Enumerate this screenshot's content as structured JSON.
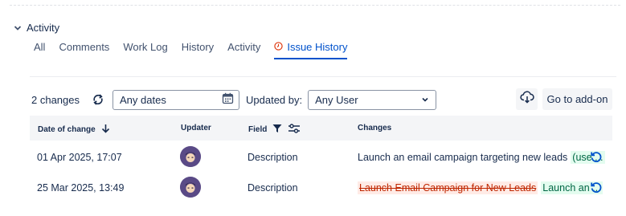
{
  "section": {
    "title": "Activity"
  },
  "tabs": [
    {
      "label": "All"
    },
    {
      "label": "Comments"
    },
    {
      "label": "Work Log"
    },
    {
      "label": "History"
    },
    {
      "label": "Activity"
    },
    {
      "label": "Issue History",
      "active": true
    }
  ],
  "toolbar": {
    "changes_count": "2 changes",
    "date_filter": "Any dates",
    "updated_by_label": "Updated by:",
    "user_filter": "Any User",
    "addon_button": "Go to add-on"
  },
  "table": {
    "columns": [
      "Date of change",
      "Updater",
      "Field",
      "Changes"
    ],
    "rows": [
      {
        "date": "01 Apr 2025, 17:07",
        "field": "Description",
        "plain_change": "Launch an email campaign targeting new leads",
        "added_change": "(use ..."
      },
      {
        "date": "25 Mar 2025, 13:49",
        "field": "Description",
        "removed_change": "Launch Email Campaign for New Leads",
        "added_change": "Launch an ..."
      }
    ]
  },
  "colors": {
    "accent": "#0052cc",
    "added_bg": "#e3fcef",
    "removed_bg": "#ffebe6",
    "avatar": "#5a4a86"
  },
  "icons": [
    "chevron-down-icon",
    "issue-history-icon",
    "refresh-icon",
    "calendar-icon",
    "chevron-down-icon",
    "cloud-download-icon",
    "arrow-down-icon",
    "filter-icon",
    "sliders-icon",
    "restore-icon"
  ]
}
